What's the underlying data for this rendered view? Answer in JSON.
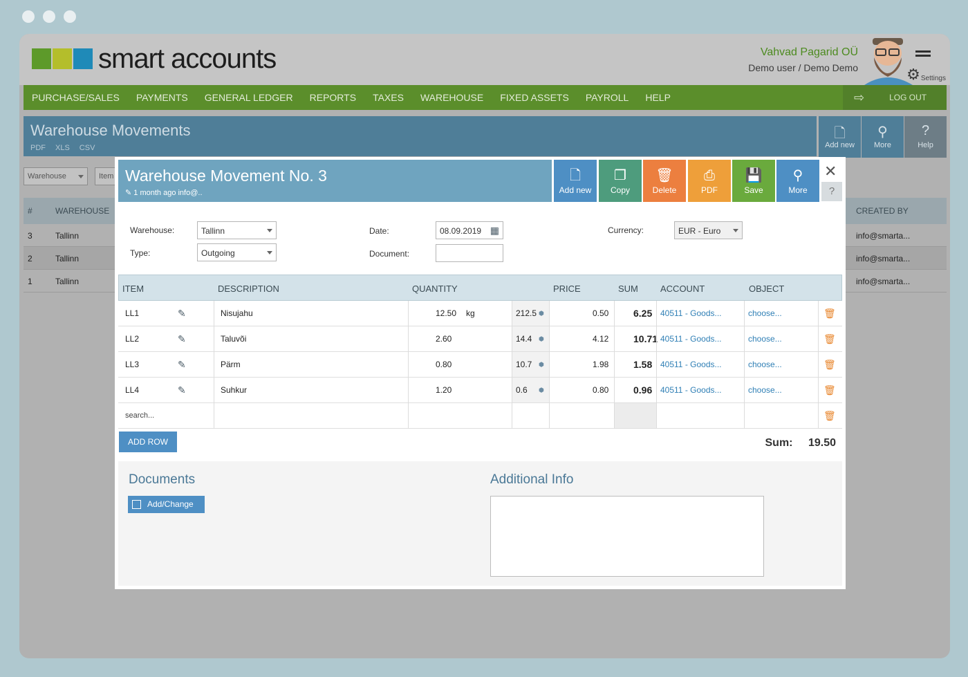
{
  "app": {
    "logo_text": "smart accounts",
    "logo_colors": [
      "#5d9a2a",
      "#b4be2b",
      "#1f8ab8"
    ],
    "company_name": "Vahvad Pagarid OÜ",
    "user_name": "Demo user / Demo Demo",
    "settings_label": "Settings"
  },
  "nav": {
    "items": [
      "PURCHASE/SALES",
      "PAYMENTS",
      "GENERAL LEDGER",
      "REPORTS",
      "TAXES",
      "WAREHOUSE",
      "FIXED ASSETS",
      "PAYROLL",
      "HELP"
    ],
    "logout": "LOG OUT"
  },
  "page": {
    "title": "Warehouse Movements",
    "exports": [
      "PDF",
      "XLS",
      "CSV"
    ],
    "buttons": {
      "add_new": "Add new",
      "more": "More",
      "help": "Help",
      "help_icon": "?"
    },
    "filters": {
      "warehouse": "Warehouse",
      "item": "Item"
    },
    "table": {
      "headers": {
        "num": "#",
        "warehouse": "WAREHOUSE",
        "created_by": "CREATED BY"
      },
      "rows": [
        {
          "num": "3",
          "warehouse": "Tallinn",
          "created_by": "info@smarta..."
        },
        {
          "num": "2",
          "warehouse": "Tallinn",
          "created_by": "info@smarta..."
        },
        {
          "num": "1",
          "warehouse": "Tallinn",
          "created_by": "info@smarta..."
        }
      ]
    }
  },
  "modal": {
    "title": "Warehouse Movement No. 3",
    "subtitle": "1 month ago info@..",
    "actions": {
      "add_new": "Add new",
      "copy": "Copy",
      "delete": "Delete",
      "pdf": "PDF",
      "save": "Save",
      "more": "More"
    },
    "action_colors": {
      "add_new": "#4e8fc4",
      "copy": "#4e9c7d",
      "delete": "#ec7f3f",
      "pdf": "#ee9f3a",
      "save": "#6aaa3d",
      "more": "#4e8fc4"
    },
    "close": "✕",
    "help": "?",
    "form": {
      "warehouse_label": "Warehouse:",
      "warehouse_value": "Tallinn",
      "type_label": "Type:",
      "type_value": "Outgoing",
      "date_label": "Date:",
      "date_value": "08.09.2019",
      "document_label": "Document:",
      "document_value": "",
      "currency_label": "Currency:",
      "currency_value": "EUR - Euro"
    },
    "grid": {
      "headers": {
        "item": "ITEM",
        "description": "DESCRIPTION",
        "quantity": "QUANTITY",
        "price": "PRICE",
        "sum": "SUM",
        "account": "ACCOUNT",
        "object": "OBJECT"
      },
      "rows": [
        {
          "item": "LL1",
          "description": "Nisujahu",
          "quantity": "12.50",
          "unit": "kg",
          "stock": "212.5",
          "price": "0.50",
          "sum": "6.25",
          "account": "40511 - Goods...",
          "object": "choose..."
        },
        {
          "item": "LL2",
          "description": "Taluvõi",
          "quantity": "2.60",
          "unit": "",
          "stock": "14.4",
          "price": "4.12",
          "sum": "10.71",
          "account": "40511 - Goods...",
          "object": "choose..."
        },
        {
          "item": "LL3",
          "description": "Pärm",
          "quantity": "0.80",
          "unit": "",
          "stock": "10.7",
          "price": "1.98",
          "sum": "1.58",
          "account": "40511 - Goods...",
          "object": "choose..."
        },
        {
          "item": "LL4",
          "description": "Suhkur",
          "quantity": "1.20",
          "unit": "",
          "stock": "0.6",
          "price": "0.80",
          "sum": "0.96",
          "account": "40511 - Goods...",
          "object": "choose..."
        }
      ],
      "search_placeholder": "search..."
    },
    "add_row": "ADD ROW",
    "sum_label": "Sum:",
    "sum_value": "19.50",
    "documents_title": "Documents",
    "add_change": "Add/Change",
    "additional_info_title": "Additional Info",
    "additional_info_value": ""
  }
}
